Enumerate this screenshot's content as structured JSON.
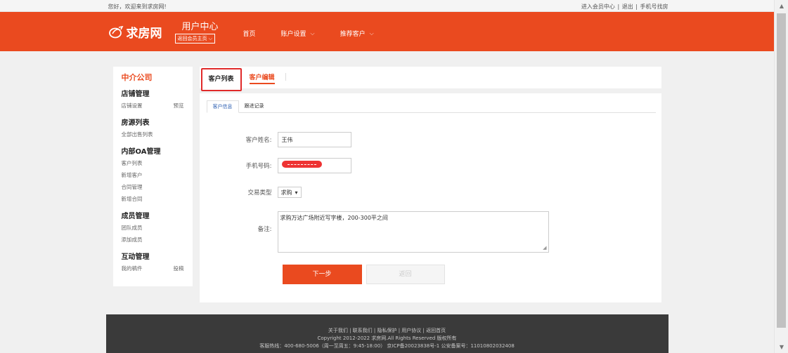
{
  "topbar": {
    "welcome": "您好，欢迎来到求房网!",
    "links": [
      "进入会员中心",
      "退出",
      "手机号找房"
    ],
    "sep": "|"
  },
  "header": {
    "brand": "求房网",
    "uc_title": "用户中心",
    "uc_back": "返回会员主页",
    "nav": [
      {
        "label": "首页",
        "dropdown": false
      },
      {
        "label": "账户设置",
        "dropdown": true
      },
      {
        "label": "推荐客户",
        "dropdown": true
      }
    ],
    "brand_color": "#ea4a1f"
  },
  "sidebar": {
    "company": "中介公司",
    "groups": [
      {
        "title": "店铺管理",
        "links": [
          {
            "label": "店铺设置",
            "right": "预览"
          }
        ]
      },
      {
        "title": "房源列表",
        "links": [
          {
            "label": "全部出售列表"
          }
        ]
      },
      {
        "title": "内部OA管理",
        "links": [
          {
            "label": "客户列表"
          },
          {
            "label": "新增客户"
          },
          {
            "label": "合同管理"
          },
          {
            "label": "新增合同"
          }
        ]
      },
      {
        "title": "成员管理",
        "links": [
          {
            "label": "团队成员"
          },
          {
            "label": "添加成员"
          }
        ]
      },
      {
        "title": "互动管理",
        "links": [
          {
            "label": "我的稿件",
            "right": "投稿"
          }
        ]
      }
    ]
  },
  "content": {
    "tabs": [
      "客户列表",
      "客户编辑"
    ],
    "subtabs": [
      "客户信息",
      "跟进记录"
    ],
    "form": {
      "name_label": "客户姓名:",
      "name_value": "王伟",
      "phone_label": "手机号码:",
      "type_label": "交易类型",
      "type_value": "求购",
      "note_label": "备注:",
      "note_value": "求购万达广场附近写字楼，200-300平之间"
    },
    "buttons": {
      "next": "下一步",
      "back": "返回"
    }
  },
  "footer": {
    "links_line": "关于我们 | 联系我们 | 隐私保护 | 用户协议 | 返回首页",
    "copyright": "Copyright 2012-2022 求房网.All Rights Reserved 版权所有",
    "contact": "客服热线：400-680-5006（周一至周五：9:45-18:00） 京ICP备20023838号-1 公安备案号：11010802032408"
  }
}
